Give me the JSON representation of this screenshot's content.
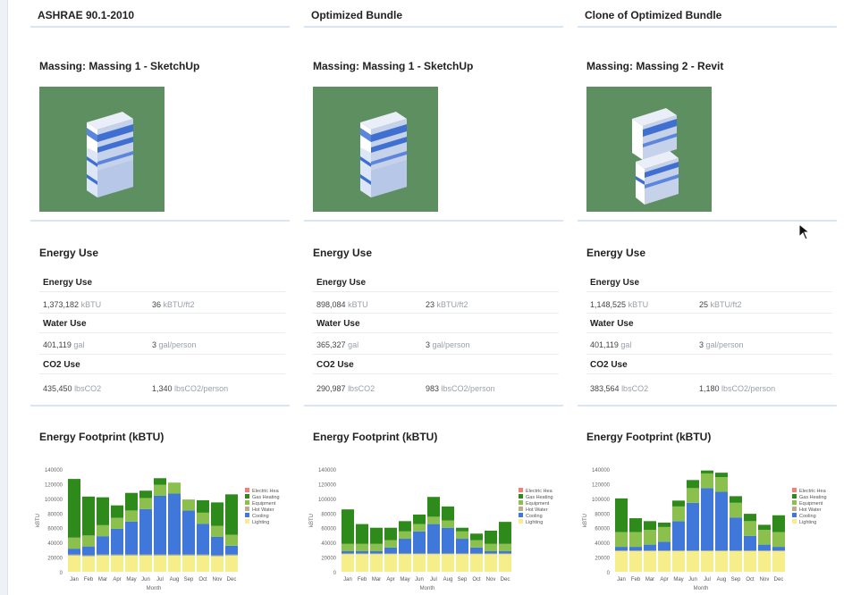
{
  "columns": [
    {
      "title": "ASHRAE 90.1-2010",
      "massing": "Massing: Massing 1 - SketchUp",
      "energy_header": "Energy Use",
      "energy_use_label": "Energy Use",
      "energy_total": "1,373,182",
      "energy_total_unit": "kBTU",
      "energy_intensity": "36",
      "energy_intensity_unit": "kBTU/ft2",
      "water_use_label": "Water Use",
      "water_total": "401,119",
      "water_total_unit": "gal",
      "water_per_person": "3",
      "water_per_person_unit": "gal/person",
      "co2_use_label": "CO2 Use",
      "co2_total": "435,450",
      "co2_total_unit": "lbsCO2",
      "co2_per_person": "1,340",
      "co2_per_person_unit": "lbsCO2/person",
      "footprint_header": "Energy Footprint (kBTU)"
    },
    {
      "title": "Optimized Bundle",
      "massing": "Massing: Massing 1 - SketchUp",
      "energy_header": "Energy Use",
      "energy_use_label": "Energy Use",
      "energy_total": "898,084",
      "energy_total_unit": "kBTU",
      "energy_intensity": "23",
      "energy_intensity_unit": "kBTU/ft2",
      "water_use_label": "Water Use",
      "water_total": "365,327",
      "water_total_unit": "gal",
      "water_per_person": "3",
      "water_per_person_unit": "gal/person",
      "co2_use_label": "CO2 Use",
      "co2_total": "290,987",
      "co2_total_unit": "lbsCO2",
      "co2_per_person": "983",
      "co2_per_person_unit": "lbsCO2/person",
      "footprint_header": "Energy Footprint (kBTU)"
    },
    {
      "title": "Clone of Optimized Bundle",
      "massing": "Massing: Massing 2 - Revit",
      "energy_header": "Energy Use",
      "energy_use_label": "Energy Use",
      "energy_total": "1,148,525",
      "energy_total_unit": "kBTU",
      "energy_intensity": "25",
      "energy_intensity_unit": "kBTU/ft2",
      "water_use_label": "Water Use",
      "water_total": "401,119",
      "water_total_unit": "gal",
      "water_per_person": "3",
      "water_per_person_unit": "gal/person",
      "co2_use_label": "CO2 Use",
      "co2_total": "383,564",
      "co2_total_unit": "lbsCO2",
      "co2_per_person": "1,180",
      "co2_per_person_unit": "lbsCO2/person",
      "footprint_header": "Energy Footprint (kBTU)"
    }
  ],
  "colors": {
    "Electric Heat": "#f08080",
    "Gas Heating": "#2f8a1c",
    "Equipment": "#8cc04e",
    "Hot Water": "#b8b08a",
    "Cooling": "#3f78d8",
    "Lighting": "#f6ee8a",
    "massing_bg": "#5e8f61"
  },
  "chart_data": [
    {
      "type": "bar",
      "stacked": true,
      "categories": [
        "Jan",
        "Feb",
        "Mar",
        "Apr",
        "May",
        "Jun",
        "Jul",
        "Aug",
        "Sep",
        "Oct",
        "Nov",
        "Dec"
      ],
      "ylabel": "kBTU",
      "xlabel": "Month",
      "ylim": [
        0,
        140000
      ],
      "yticks": [
        "0",
        "20000",
        "40000",
        "60000",
        "80000",
        "100000",
        "120000",
        "140000"
      ],
      "legend": [
        "Electric Hea",
        "Gas Heating",
        "Equipment",
        "Hot Water",
        "Cooling",
        "Lighting"
      ],
      "series": [
        {
          "name": "Lighting",
          "values": [
            22000,
            21000,
            22000,
            22000,
            22000,
            22000,
            22000,
            22000,
            22000,
            22000,
            21000,
            22000
          ]
        },
        {
          "name": "Hot Water",
          "values": [
            1500,
            1500,
            1500,
            1500,
            1500,
            1500,
            1500,
            1500,
            1500,
            1500,
            1500,
            1500
          ]
        },
        {
          "name": "Cooling",
          "values": [
            8000,
            12000,
            25000,
            35000,
            45000,
            62000,
            80000,
            83000,
            60000,
            42000,
            25000,
            12000
          ]
        },
        {
          "name": "Equipment",
          "values": [
            15000,
            15000,
            15000,
            15000,
            15000,
            15000,
            15000,
            15000,
            15000,
            15000,
            15000,
            15000
          ]
        },
        {
          "name": "Gas Heating",
          "values": [
            80000,
            53000,
            38000,
            17000,
            24000,
            10000,
            9000,
            0,
            0,
            17000,
            32000,
            55000
          ]
        },
        {
          "name": "Electric Hea",
          "values": [
            0,
            0,
            0,
            0,
            0,
            0,
            0,
            0,
            0,
            0,
            0,
            0
          ]
        }
      ]
    },
    {
      "type": "bar",
      "stacked": true,
      "categories": [
        "Jan",
        "Feb",
        "Mar",
        "Apr",
        "May",
        "Jun",
        "Jul",
        "Aug",
        "Sep",
        "Oct",
        "Nov",
        "Dec"
      ],
      "ylabel": "kBTU",
      "xlabel": "Month",
      "ylim": [
        0,
        140000
      ],
      "yticks": [
        "0",
        "20000",
        "40000",
        "60000",
        "80000",
        "100000",
        "120000",
        "140000"
      ],
      "legend": [
        "Electric Hea",
        "Gas Heating",
        "Equipment",
        "Hot Water",
        "Cooling",
        "Lighting"
      ],
      "series": [
        {
          "name": "Lighting",
          "values": [
            24000,
            24000,
            24000,
            24000,
            24000,
            24000,
            24000,
            24000,
            24000,
            24000,
            24000,
            24000
          ]
        },
        {
          "name": "Hot Water",
          "values": [
            1000,
            1000,
            1000,
            1000,
            1000,
            1000,
            1000,
            1000,
            1000,
            1000,
            1000,
            1000
          ]
        },
        {
          "name": "Cooling",
          "values": [
            3000,
            3000,
            3000,
            8000,
            20000,
            30000,
            40000,
            35000,
            20000,
            8000,
            3000,
            3000
          ]
        },
        {
          "name": "Equipment",
          "values": [
            10000,
            10000,
            10000,
            10000,
            10000,
            10000,
            10000,
            10000,
            10000,
            10000,
            10000,
            10000
          ]
        },
        {
          "name": "Gas Heating",
          "values": [
            47000,
            27000,
            22000,
            17000,
            14000,
            13000,
            27000,
            19000,
            5000,
            9000,
            18000,
            30000
          ]
        },
        {
          "name": "Electric Hea",
          "values": [
            0,
            0,
            0,
            0,
            0,
            0,
            0,
            0,
            0,
            0,
            0,
            0
          ]
        }
      ]
    },
    {
      "type": "bar",
      "stacked": true,
      "categories": [
        "Jan",
        "Feb",
        "Mar",
        "Apr",
        "May",
        "Jun",
        "Jul",
        "Aug",
        "Sep",
        "Oct",
        "Nov",
        "Dec"
      ],
      "ylabel": "kBTU",
      "xlabel": "Month",
      "ylim": [
        0,
        140000
      ],
      "yticks": [
        "0",
        "20000",
        "40000",
        "60000",
        "80000",
        "100000",
        "120000",
        "140000"
      ],
      "legend": [
        "Electric Hea",
        "Gas Heating",
        "Equipment",
        "Hot Water",
        "Cooling",
        "Lighting"
      ],
      "series": [
        {
          "name": "Lighting",
          "values": [
            28000,
            28000,
            28000,
            28000,
            28000,
            28000,
            28000,
            28000,
            28000,
            28000,
            28000,
            28000
          ]
        },
        {
          "name": "Hot Water",
          "values": [
            1000,
            1000,
            1000,
            1000,
            1000,
            1000,
            1000,
            1000,
            1000,
            1000,
            1000,
            1000
          ]
        },
        {
          "name": "Cooling",
          "values": [
            5000,
            5000,
            8000,
            12000,
            40000,
            65000,
            85000,
            80000,
            45000,
            20000,
            8000,
            5000
          ]
        },
        {
          "name": "Equipment",
          "values": [
            20000,
            20000,
            20000,
            20000,
            20000,
            20000,
            20000,
            20000,
            20000,
            20000,
            20000,
            20000
          ]
        },
        {
          "name": "Gas Heating",
          "values": [
            46000,
            19000,
            12000,
            6000,
            8000,
            11000,
            4000,
            6000,
            9000,
            10000,
            7000,
            23000
          ]
        },
        {
          "name": "Electric Hea",
          "values": [
            0,
            0,
            0,
            0,
            0,
            0,
            0,
            0,
            0,
            0,
            0,
            0
          ]
        }
      ]
    }
  ]
}
